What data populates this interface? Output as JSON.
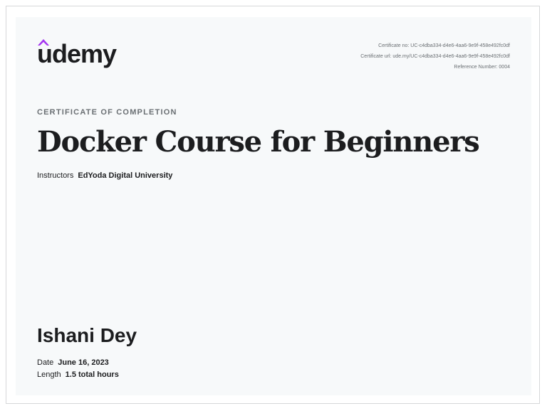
{
  "brand": {
    "logo_text": "udemy",
    "accent_color": "#a435f0",
    "text_color": "#1c1d1f"
  },
  "meta": {
    "certificate_no": "Certificate no: UC-c4dba334-d4e6-4aa6-9e9f-458e492fc0df",
    "certificate_url": "Certificate url: ude.my/UC-c4dba334-d4e6-4aa6-9e9f-458e492fc0df",
    "reference_number": "Reference Number: 0004"
  },
  "certificate": {
    "kicker": "CERTIFICATE OF COMPLETION",
    "course_title": "Docker Course for Beginners",
    "instructors_label": "Instructors",
    "instructors_value": "EdYoda Digital University",
    "recipient_name": "Ishani Dey",
    "date_label": "Date",
    "date_value": "June 16, 2023",
    "length_label": "Length",
    "length_value": "1.5 total hours"
  }
}
